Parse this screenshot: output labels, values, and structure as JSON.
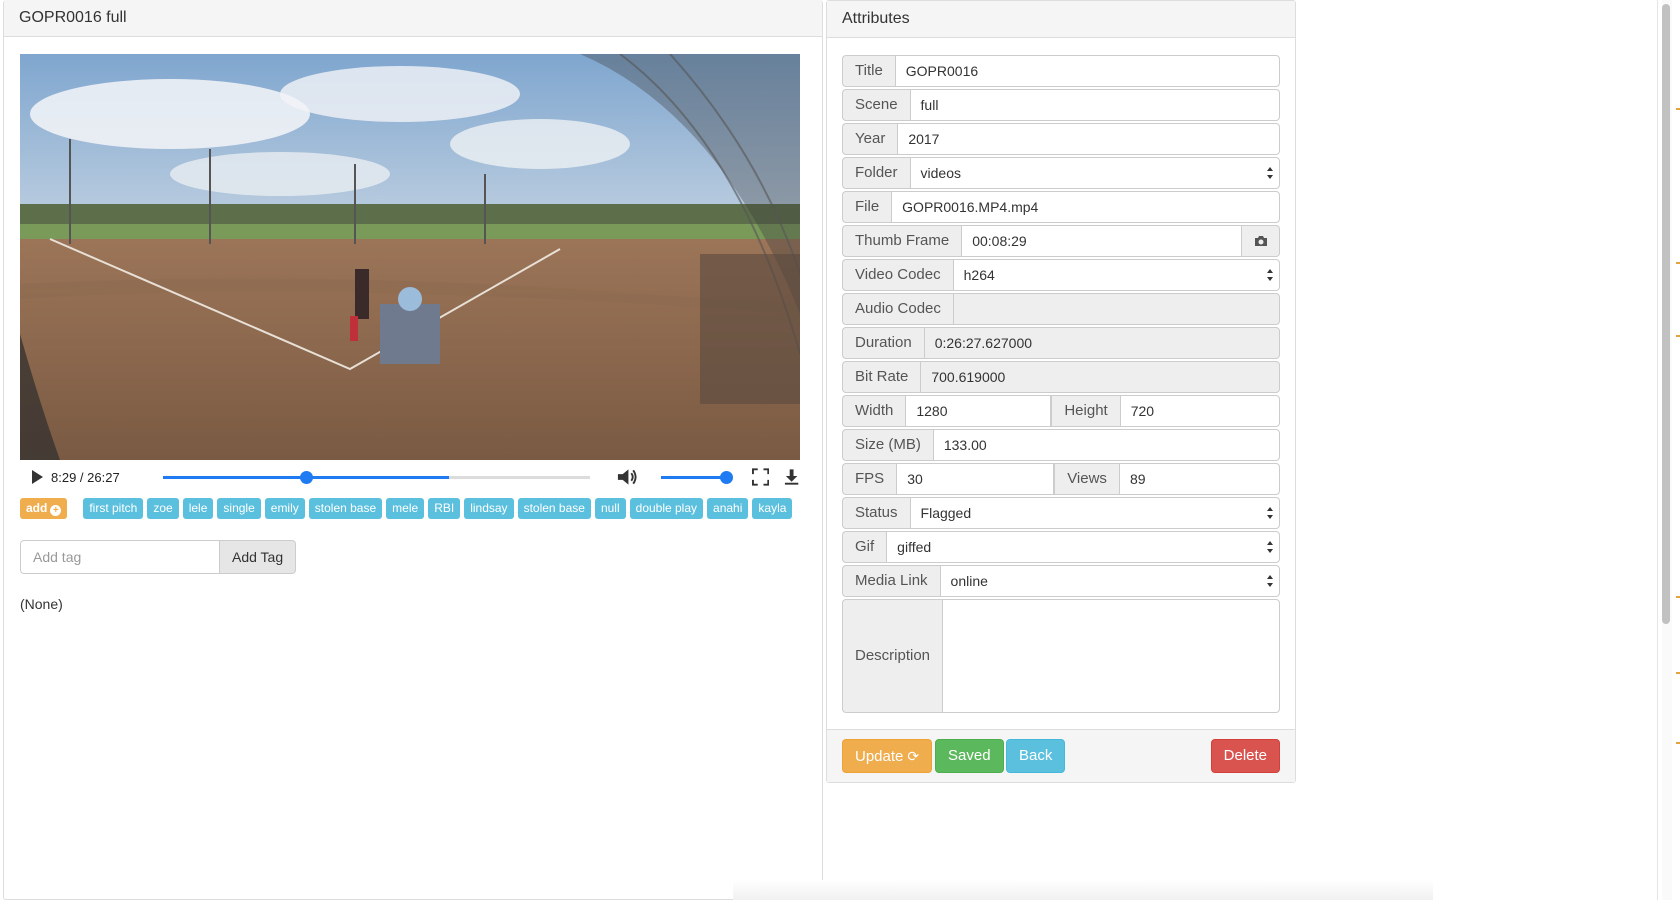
{
  "video_panel": {
    "title": "GOPR0016 full",
    "player": {
      "time_display": "8:29 / 26:27",
      "progress": 0.32,
      "buffered": 0.64,
      "volume": 1.0
    },
    "add_label": "add",
    "tags": [
      "first pitch",
      "zoe",
      "lele",
      "single",
      "emily",
      "stolen base",
      "mele",
      "RBI",
      "lindsay",
      "stolen base",
      "null",
      "double play",
      "anahi",
      "kayla"
    ],
    "add_tag_placeholder": "Add tag",
    "add_tag_button": "Add Tag",
    "none_text": "(None)"
  },
  "attributes": {
    "heading": "Attributes",
    "title_label": "Title",
    "title_value": "GOPR0016",
    "scene_label": "Scene",
    "scene_value": "full",
    "year_label": "Year",
    "year_value": "2017",
    "folder_label": "Folder",
    "folder_value": "videos",
    "file_label": "File",
    "file_value": "GOPR0016.MP4.mp4",
    "thumb_label": "Thumb Frame",
    "thumb_value": "00:08:29",
    "vcodec_label": "Video Codec",
    "vcodec_value": "h264",
    "acodec_label": "Audio Codec",
    "acodec_value": "",
    "duration_label": "Duration",
    "duration_value": "0:26:27.627000",
    "bitrate_label": "Bit Rate",
    "bitrate_value": "700.619000",
    "width_label": "Width",
    "width_value": "1280",
    "height_label": "Height",
    "height_value": "720",
    "size_label": "Size (MB)",
    "size_value": "133.00",
    "fps_label": "FPS",
    "fps_value": "30",
    "views_label": "Views",
    "views_value": "89",
    "status_label": "Status",
    "status_value": "Flagged",
    "gif_label": "Gif",
    "gif_value": "giffed",
    "media_label": "Media Link",
    "media_value": "online",
    "desc_label": "Description",
    "desc_value": ""
  },
  "footer": {
    "update": "Update",
    "saved": "Saved",
    "back": "Back",
    "delete": "Delete"
  },
  "colors": {
    "warning": "#f0ad4e",
    "info": "#5bc0de",
    "success": "#5cb85c",
    "danger": "#d9534f",
    "player_accent": "#1e7bf2"
  }
}
